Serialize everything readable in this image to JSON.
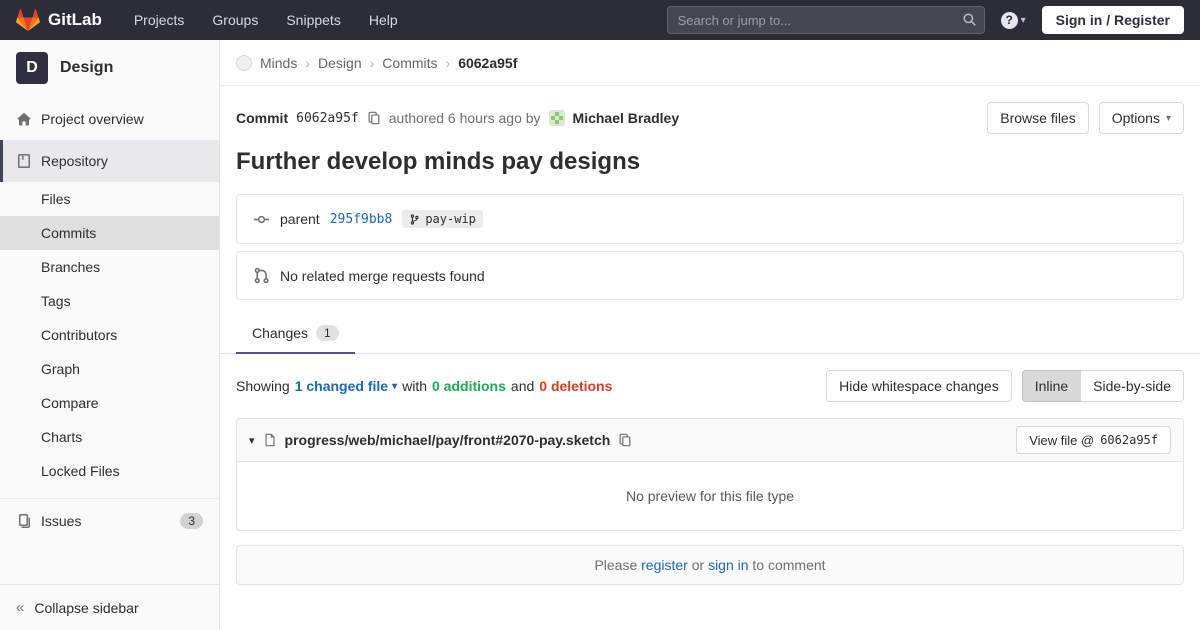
{
  "navbar": {
    "brand": "GitLab",
    "menu": [
      "Projects",
      "Groups",
      "Snippets",
      "Help"
    ],
    "search_placeholder": "Search or jump to...",
    "sign_in_label": "Sign in / Register"
  },
  "sidebar": {
    "project_initial": "D",
    "project_name": "Design",
    "overview": "Project overview",
    "repository": "Repository",
    "repo_subitems": [
      "Files",
      "Commits",
      "Branches",
      "Tags",
      "Contributors",
      "Graph",
      "Compare",
      "Charts",
      "Locked Files"
    ],
    "issues": "Issues",
    "issues_badge": "3",
    "collapse_label": "Collapse sidebar"
  },
  "breadcrumb": {
    "items": [
      "Minds",
      "Design",
      "Commits"
    ],
    "current": "6062a95f"
  },
  "commit": {
    "label": "Commit",
    "sha": "6062a95f",
    "authored": "authored 6 hours ago by",
    "author": "Michael Bradley",
    "browse_files": "Browse files",
    "options": "Options",
    "title": "Further develop minds pay designs",
    "parent_label": "parent",
    "parent_sha": "295f9bb8",
    "branch": "pay-wip",
    "no_mr": "No related merge requests found"
  },
  "tabs": {
    "changes": "Changes",
    "changes_count": "1"
  },
  "diff": {
    "showing": "Showing",
    "changed_file": "1 changed file",
    "with_word": "with",
    "additions": "0 additions",
    "and_word": "and",
    "deletions": "0 deletions",
    "hide_whitespace": "Hide whitespace changes",
    "inline": "Inline",
    "side_by_side": "Side-by-side",
    "file_path": "progress/web/michael/pay/front#2070-pay.sketch",
    "view_file": "View file @",
    "view_file_sha": "6062a95f",
    "no_preview": "No preview for this file type"
  },
  "comment": {
    "please": "Please",
    "register": "register",
    "or_word": "or",
    "sign_in": "sign in",
    "to_comment": "to comment"
  },
  "colors": {
    "navbar_bg": "#2d2d3a",
    "brand_orange": "#fc6d26",
    "link_blue": "#1b69b6",
    "additions_green": "#1aaa55",
    "deletions_red": "#db3b21",
    "tab_accent": "#51519c"
  }
}
